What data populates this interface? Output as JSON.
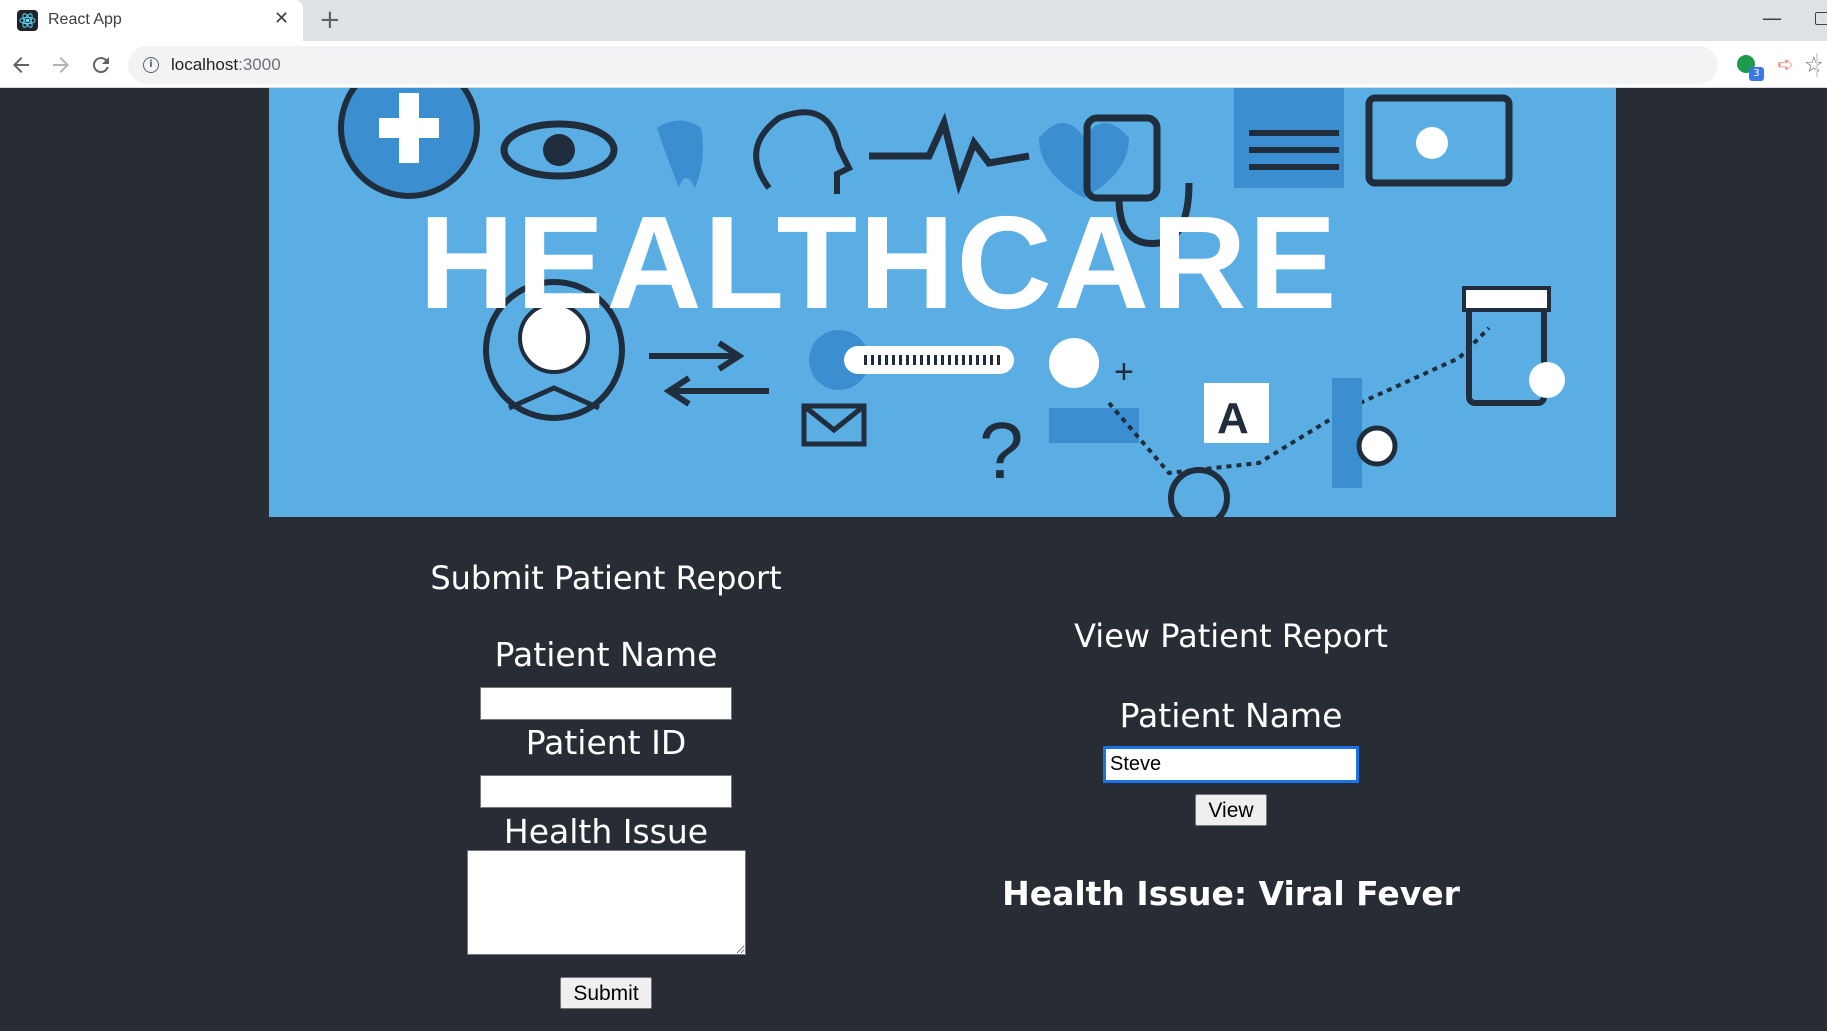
{
  "browser": {
    "tab_title": "React App",
    "url_host": "localhost",
    "url_port": ":3000",
    "extension_badge": "3"
  },
  "banner": {
    "word": "HEALTHCARE"
  },
  "submit_form": {
    "title": "Submit Patient Report",
    "patient_name_label": "Patient Name",
    "patient_name_value": "",
    "patient_id_label": "Patient ID",
    "patient_id_value": "",
    "health_issue_label": "Health Issue",
    "health_issue_value": "",
    "submit_label": "Submit"
  },
  "view_form": {
    "title": "View Patient Report",
    "patient_name_label": "Patient Name",
    "patient_name_value": "Steve",
    "view_label": "View",
    "result": "Health Issue: Viral Fever"
  },
  "colors": {
    "page_bg": "#282c34",
    "banner_bg": "#5aaee3",
    "banner_dark": "#2b3a4a"
  }
}
